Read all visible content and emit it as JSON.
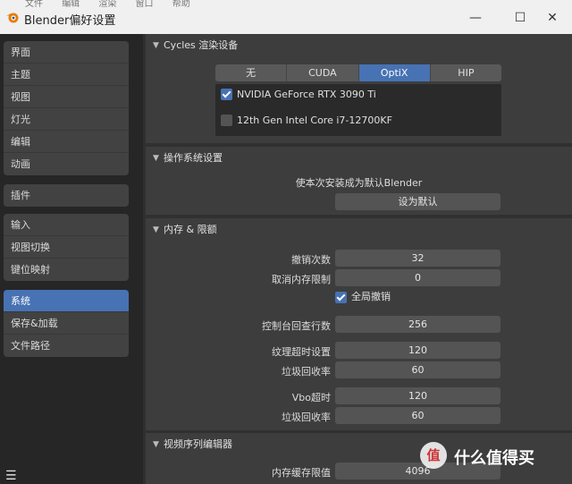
{
  "window": {
    "title": "Blender偏好设置",
    "menu_hint": [
      "文件",
      "编辑",
      "渲染",
      "窗口",
      "帮助"
    ],
    "minimize_glyph": "—",
    "maximize_glyph": "☐",
    "close_glyph": "✕"
  },
  "sidebar": {
    "groups": [
      [
        "界面",
        "主题",
        "视图",
        "灯光",
        "编辑",
        "动画"
      ],
      [
        "插件"
      ],
      [
        "输入",
        "视图切换",
        "键位映射"
      ],
      [
        "系统",
        "保存&加载",
        "文件路径"
      ]
    ],
    "active": "系统",
    "menu_glyph": "☰"
  },
  "cycles": {
    "title": "Cycles 渲染设备",
    "tabs": [
      "无",
      "CUDA",
      "OptiX",
      "HIP"
    ],
    "active_tab": "OptiX",
    "devices": [
      {
        "name": "NVIDIA GeForce RTX 3090 Ti",
        "checked": true
      },
      {
        "name": "12th Gen Intel Core i7-12700KF",
        "checked": false
      }
    ]
  },
  "os": {
    "title": "操作系统设置",
    "description": "使本次安装成为默认Blender",
    "button": "设为默认"
  },
  "memory": {
    "title": "内存 & 限额",
    "undo_steps_label": "撤销次数",
    "undo_steps_value": "32",
    "undo_memory_label": "取消内存限制",
    "undo_memory_value": "0",
    "global_undo_label": "全局撤销",
    "global_undo_checked": true,
    "console_label": "控制台回查行数",
    "console_value": "256",
    "texture_timeout_label": "纹理超时设置",
    "texture_timeout_value": "120",
    "texture_gc_label": "垃圾回收率",
    "texture_gc_value": "60",
    "vbo_timeout_label": "Vbo超时",
    "vbo_timeout_value": "120",
    "vbo_gc_label": "垃圾回收率",
    "vbo_gc_value": "60"
  },
  "sequencer": {
    "title": "视频序列编辑器",
    "cache_label": "内存缓存限值",
    "cache_value": "4096"
  },
  "watermark": {
    "logo_glyph": "值",
    "text": "什么值得买"
  },
  "colors": {
    "accent": "#4772b3",
    "panel": "#3d3d3d",
    "field": "#545454"
  }
}
